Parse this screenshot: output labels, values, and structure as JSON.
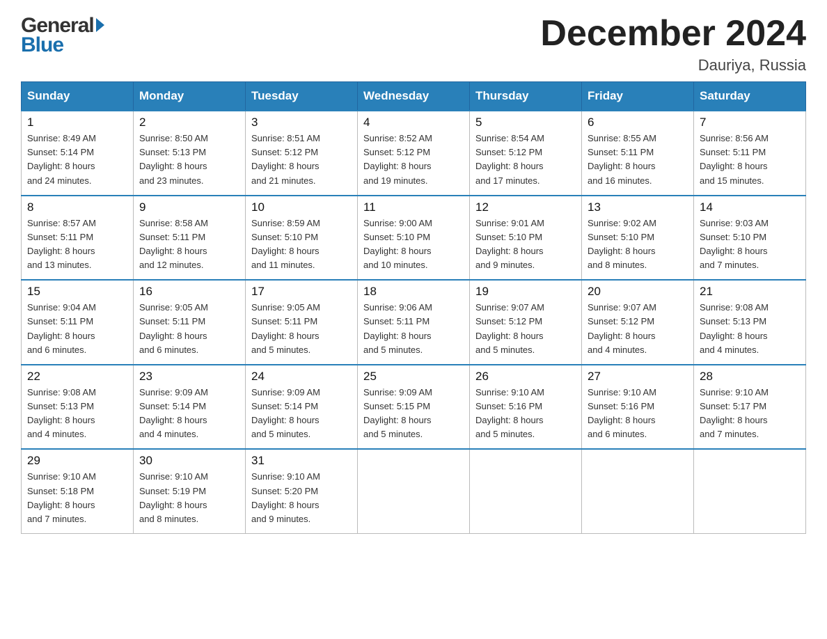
{
  "header": {
    "month_title": "December 2024",
    "location": "Dauriya, Russia"
  },
  "logo": {
    "general": "General",
    "blue": "Blue"
  },
  "columns": [
    "Sunday",
    "Monday",
    "Tuesday",
    "Wednesday",
    "Thursday",
    "Friday",
    "Saturday"
  ],
  "weeks": [
    [
      {
        "day": "1",
        "sunrise": "8:49 AM",
        "sunset": "5:14 PM",
        "daylight": "8 hours and 24 minutes."
      },
      {
        "day": "2",
        "sunrise": "8:50 AM",
        "sunset": "5:13 PM",
        "daylight": "8 hours and 23 minutes."
      },
      {
        "day": "3",
        "sunrise": "8:51 AM",
        "sunset": "5:12 PM",
        "daylight": "8 hours and 21 minutes."
      },
      {
        "day": "4",
        "sunrise": "8:52 AM",
        "sunset": "5:12 PM",
        "daylight": "8 hours and 19 minutes."
      },
      {
        "day": "5",
        "sunrise": "8:54 AM",
        "sunset": "5:12 PM",
        "daylight": "8 hours and 17 minutes."
      },
      {
        "day": "6",
        "sunrise": "8:55 AM",
        "sunset": "5:11 PM",
        "daylight": "8 hours and 16 minutes."
      },
      {
        "day": "7",
        "sunrise": "8:56 AM",
        "sunset": "5:11 PM",
        "daylight": "8 hours and 15 minutes."
      }
    ],
    [
      {
        "day": "8",
        "sunrise": "8:57 AM",
        "sunset": "5:11 PM",
        "daylight": "8 hours and 13 minutes."
      },
      {
        "day": "9",
        "sunrise": "8:58 AM",
        "sunset": "5:11 PM",
        "daylight": "8 hours and 12 minutes."
      },
      {
        "day": "10",
        "sunrise": "8:59 AM",
        "sunset": "5:10 PM",
        "daylight": "8 hours and 11 minutes."
      },
      {
        "day": "11",
        "sunrise": "9:00 AM",
        "sunset": "5:10 PM",
        "daylight": "8 hours and 10 minutes."
      },
      {
        "day": "12",
        "sunrise": "9:01 AM",
        "sunset": "5:10 PM",
        "daylight": "8 hours and 9 minutes."
      },
      {
        "day": "13",
        "sunrise": "9:02 AM",
        "sunset": "5:10 PM",
        "daylight": "8 hours and 8 minutes."
      },
      {
        "day": "14",
        "sunrise": "9:03 AM",
        "sunset": "5:10 PM",
        "daylight": "8 hours and 7 minutes."
      }
    ],
    [
      {
        "day": "15",
        "sunrise": "9:04 AM",
        "sunset": "5:11 PM",
        "daylight": "8 hours and 6 minutes."
      },
      {
        "day": "16",
        "sunrise": "9:05 AM",
        "sunset": "5:11 PM",
        "daylight": "8 hours and 6 minutes."
      },
      {
        "day": "17",
        "sunrise": "9:05 AM",
        "sunset": "5:11 PM",
        "daylight": "8 hours and 5 minutes."
      },
      {
        "day": "18",
        "sunrise": "9:06 AM",
        "sunset": "5:11 PM",
        "daylight": "8 hours and 5 minutes."
      },
      {
        "day": "19",
        "sunrise": "9:07 AM",
        "sunset": "5:12 PM",
        "daylight": "8 hours and 5 minutes."
      },
      {
        "day": "20",
        "sunrise": "9:07 AM",
        "sunset": "5:12 PM",
        "daylight": "8 hours and 4 minutes."
      },
      {
        "day": "21",
        "sunrise": "9:08 AM",
        "sunset": "5:13 PM",
        "daylight": "8 hours and 4 minutes."
      }
    ],
    [
      {
        "day": "22",
        "sunrise": "9:08 AM",
        "sunset": "5:13 PM",
        "daylight": "8 hours and 4 minutes."
      },
      {
        "day": "23",
        "sunrise": "9:09 AM",
        "sunset": "5:14 PM",
        "daylight": "8 hours and 4 minutes."
      },
      {
        "day": "24",
        "sunrise": "9:09 AM",
        "sunset": "5:14 PM",
        "daylight": "8 hours and 5 minutes."
      },
      {
        "day": "25",
        "sunrise": "9:09 AM",
        "sunset": "5:15 PM",
        "daylight": "8 hours and 5 minutes."
      },
      {
        "day": "26",
        "sunrise": "9:10 AM",
        "sunset": "5:16 PM",
        "daylight": "8 hours and 5 minutes."
      },
      {
        "day": "27",
        "sunrise": "9:10 AM",
        "sunset": "5:16 PM",
        "daylight": "8 hours and 6 minutes."
      },
      {
        "day": "28",
        "sunrise": "9:10 AM",
        "sunset": "5:17 PM",
        "daylight": "8 hours and 7 minutes."
      }
    ],
    [
      {
        "day": "29",
        "sunrise": "9:10 AM",
        "sunset": "5:18 PM",
        "daylight": "8 hours and 7 minutes."
      },
      {
        "day": "30",
        "sunrise": "9:10 AM",
        "sunset": "5:19 PM",
        "daylight": "8 hours and 8 minutes."
      },
      {
        "day": "31",
        "sunrise": "9:10 AM",
        "sunset": "5:20 PM",
        "daylight": "8 hours and 9 minutes."
      },
      null,
      null,
      null,
      null
    ]
  ],
  "labels": {
    "sunrise": "Sunrise:",
    "sunset": "Sunset:",
    "daylight": "Daylight:"
  }
}
